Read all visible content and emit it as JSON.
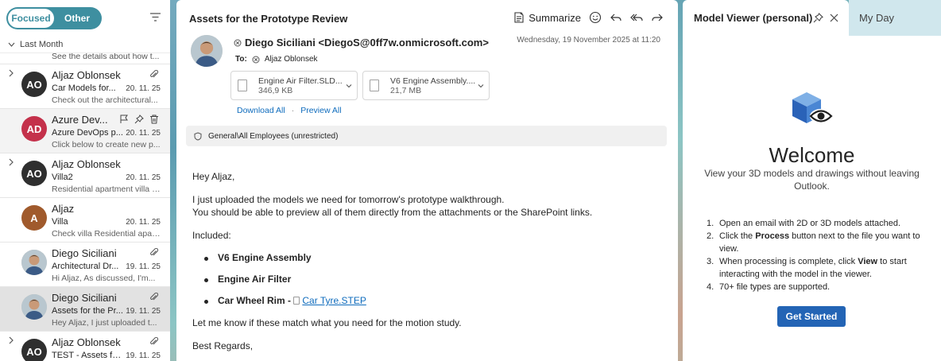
{
  "list": {
    "focused_label": "Focused",
    "other_label": "Other",
    "group_label": "Last Month",
    "partial_preview": "See the details about how t...",
    "items": [
      {
        "initials": "AO",
        "sender": "Aljaz Oblonsek",
        "subject": "Car Models for...",
        "date": "20. 11. 25",
        "preview": "Check out the architectural..."
      },
      {
        "initials": "AD",
        "sender": "Azure Dev...",
        "subject": "Azure DevOps p...",
        "date": "20. 11. 25",
        "preview": "Click below to create new p..."
      },
      {
        "initials": "AO",
        "sender": "Aljaz Oblonsek",
        "subject": "Villa2",
        "date": "20. 11. 25",
        "preview": "Residential apartment villa t..."
      },
      {
        "initials": "A",
        "sender": "Aljaz",
        "subject": "Villa",
        "date": "20. 11. 25",
        "preview": "Check villa Residential apar..."
      },
      {
        "initials": "",
        "sender": "Diego Siciliani",
        "subject": "Architectural Dr...",
        "date": "19. 11. 25",
        "preview": "Hi Aljaz, As discussed, I'm..."
      },
      {
        "initials": "",
        "sender": "Diego Siciliani",
        "subject": "Assets for the Pr...",
        "date": "19. 11. 25",
        "preview": "Hey Aljaz, I just uploaded t..."
      },
      {
        "initials": "AO",
        "sender": "Aljaz Oblonsek",
        "subject": "TEST - Assets fo...",
        "date": "19. 11. 25",
        "preview": ""
      }
    ]
  },
  "reading": {
    "subject": "Assets for the Prototype Review",
    "summarize_label": "Summarize",
    "from": "Diego Siciliani <DiegoS@0ff7w.onmicrosoft.com>",
    "date": "Wednesday, 19 November 2025 at 11:20",
    "to_label": "To:",
    "to": "Aljaz Oblonsek",
    "attachments": [
      {
        "name": "Engine Air Filter.SLD...",
        "size": "346,9 KB"
      },
      {
        "name": "V6 Engine Assembly....",
        "size": "21,7 MB"
      }
    ],
    "download_all": "Download All",
    "preview_all": "Preview All",
    "sensitivity": "General\\All Employees (unrestricted)",
    "greeting": "Hey Aljaz,",
    "line1": "I just uploaded the models we need for tomorrow's prototype walkthrough.",
    "line2": "You should be able to preview all of them directly from the attachments or the SharePoint links.",
    "included": "Included:",
    "bullet1": "V6 Engine Assembly",
    "bullet2": "Engine Air Filter",
    "bullet3": "Car Wheel Rim -",
    "bullet3_link": "Car Tyre.STEP",
    "closing": "Let me know if these match what you need for the motion study.",
    "signoff": "Best Regards,"
  },
  "side": {
    "active_tab": "Model Viewer (personal)",
    "other_tab": "My Day",
    "welcome": "Welcome",
    "sub": "View your 3D models and drawings without leaving Outlook.",
    "steps": [
      {
        "n": "1.",
        "pre": "Open an email with 2D or 3D models attached.",
        "bold": "",
        "post": ""
      },
      {
        "n": "2.",
        "pre": "Click the ",
        "bold": "Process",
        "post": " button next to the file you want to view."
      },
      {
        "n": "3.",
        "pre": "When processing is complete, click ",
        "bold": "View",
        "post": " to start interacting with the model in the viewer."
      },
      {
        "n": "4.",
        "pre": "70+ file types are supported.",
        "bold": "",
        "post": ""
      }
    ],
    "cta": "Get Started"
  },
  "colors": {
    "accent": "#3e8fa0",
    "link": "#0f6cbd",
    "primary_button": "#2364b5"
  }
}
